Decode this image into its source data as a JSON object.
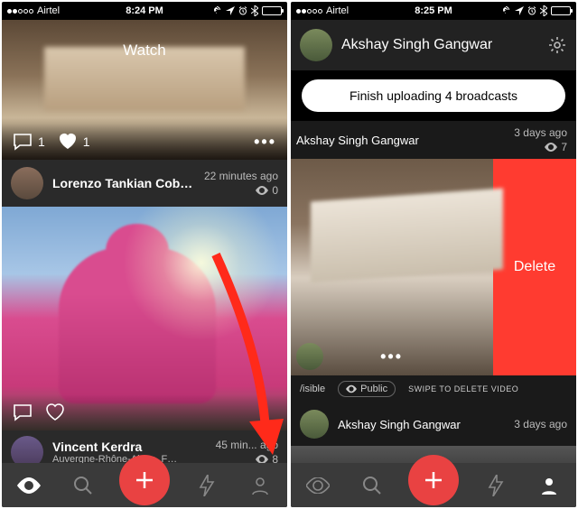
{
  "left": {
    "status": {
      "carrier": "Airtel",
      "time": "8:24 PM"
    },
    "title": "Watch",
    "top_video": {
      "comments": 1,
      "likes": 1
    },
    "item1": {
      "name": "Lorenzo Tankian Cob…",
      "time": "22 minutes ago",
      "views": 0
    },
    "item2": {
      "name": "Vincent Kerdra",
      "sub": "Auvergne-Rhône-Alpes, F…",
      "time": "45 min... ago",
      "views": 8
    }
  },
  "right": {
    "status": {
      "carrier": "Airtel",
      "time": "8:25 PM"
    },
    "profile_name": "Akshay Singh Gangwar",
    "banner": "Finish uploading 4 broadcasts",
    "item1": {
      "name": "Akshay Singh Gangwar",
      "time": "3 days ago",
      "views": 7
    },
    "delete_label": "Delete",
    "visibility": {
      "short": "/isible",
      "public": "Public",
      "hint": "SWIPE TO DELETE VIDEO"
    },
    "item2": {
      "name": "Akshay Singh Gangwar",
      "time": "3 days ago"
    }
  }
}
